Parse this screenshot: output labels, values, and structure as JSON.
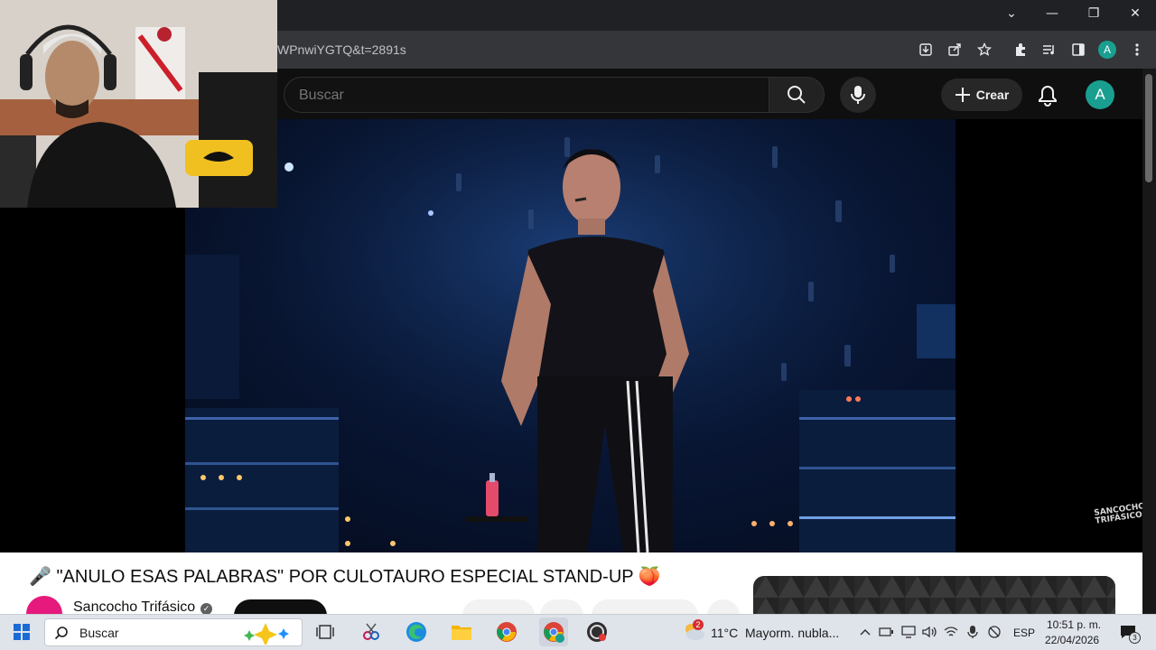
{
  "browser": {
    "url_fragment": "WPnwiYGTQ&t=2891s",
    "profile_initial": "A",
    "window_controls": {
      "minimize": "—",
      "restore": "❐",
      "close": "✕",
      "dropdown": "⌄"
    }
  },
  "youtube": {
    "search": {
      "placeholder": "Buscar"
    },
    "create_label": "Crear",
    "avatar_initial": "A"
  },
  "video": {
    "title": "🎤 \"ANULO ESAS PALABRAS\" POR CULOTAURO ESPECIAL STAND-UP 🍑",
    "channel_name": "Sancocho Trifásico",
    "watermark": "SANCOCHO TRIFÁSICO"
  },
  "taskbar": {
    "search_label": "Buscar",
    "weather_temp": "11°C",
    "weather_text": "Mayorm. nubla...",
    "weather_badge": "2",
    "language": "ESP",
    "time": "10:51 p. m.",
    "date": "22/04/2026",
    "notification_count": "3"
  }
}
